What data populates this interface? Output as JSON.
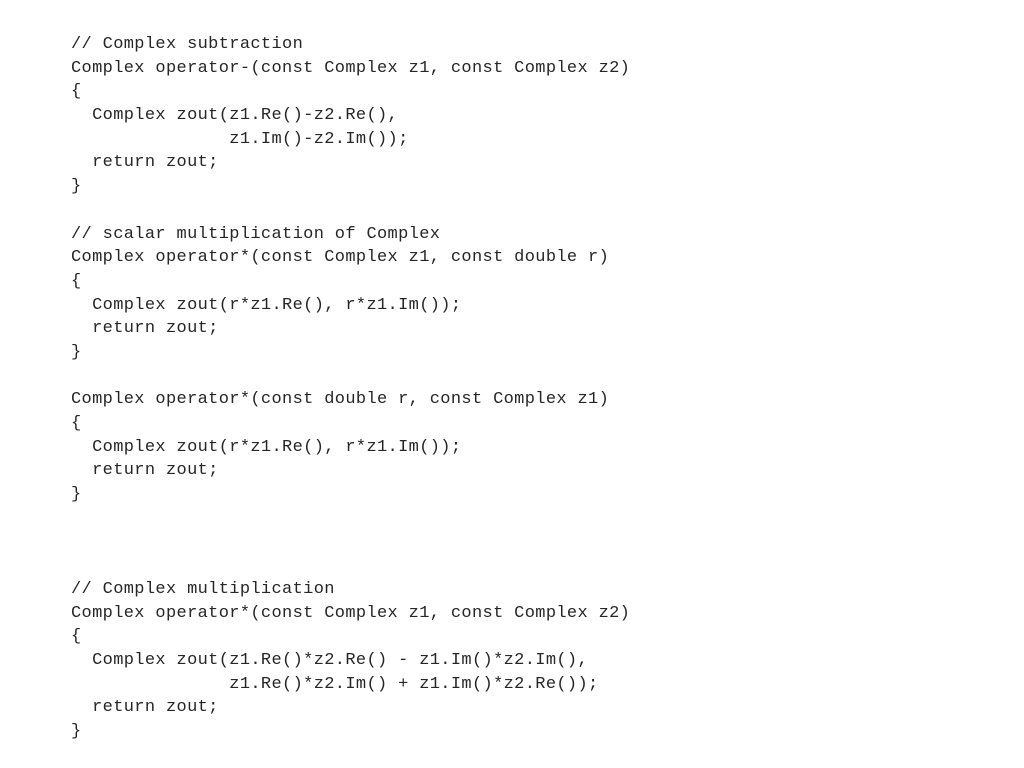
{
  "document": {
    "kind": "source-code-listing",
    "language": "C++",
    "background_color": "#ffffff",
    "text_color": "#262626"
  },
  "code": {
    "lines": [
      "// Complex subtraction",
      "Complex operator-(const Complex z1, const Complex z2)",
      "{",
      "  Complex zout(z1.Re()-z2.Re(),",
      "               z1.Im()-z2.Im());",
      "  return zout;",
      "}",
      "",
      "// scalar multiplication of Complex",
      "Complex operator*(const Complex z1, const double r)",
      "{",
      "  Complex zout(r*z1.Re(), r*z1.Im());",
      "  return zout;",
      "}",
      "",
      "Complex operator*(const double r, const Complex z1)",
      "{",
      "  Complex zout(r*z1.Re(), r*z1.Im());",
      "  return zout;",
      "}",
      "",
      "",
      "",
      "// Complex multiplication",
      "Complex operator*(const Complex z1, const Complex z2)",
      "{",
      "  Complex zout(z1.Re()*z2.Re() - z1.Im()*z2.Im(),",
      "               z1.Re()*z2.Im() + z1.Im()*z2.Re());",
      "  return zout;",
      "}"
    ]
  }
}
